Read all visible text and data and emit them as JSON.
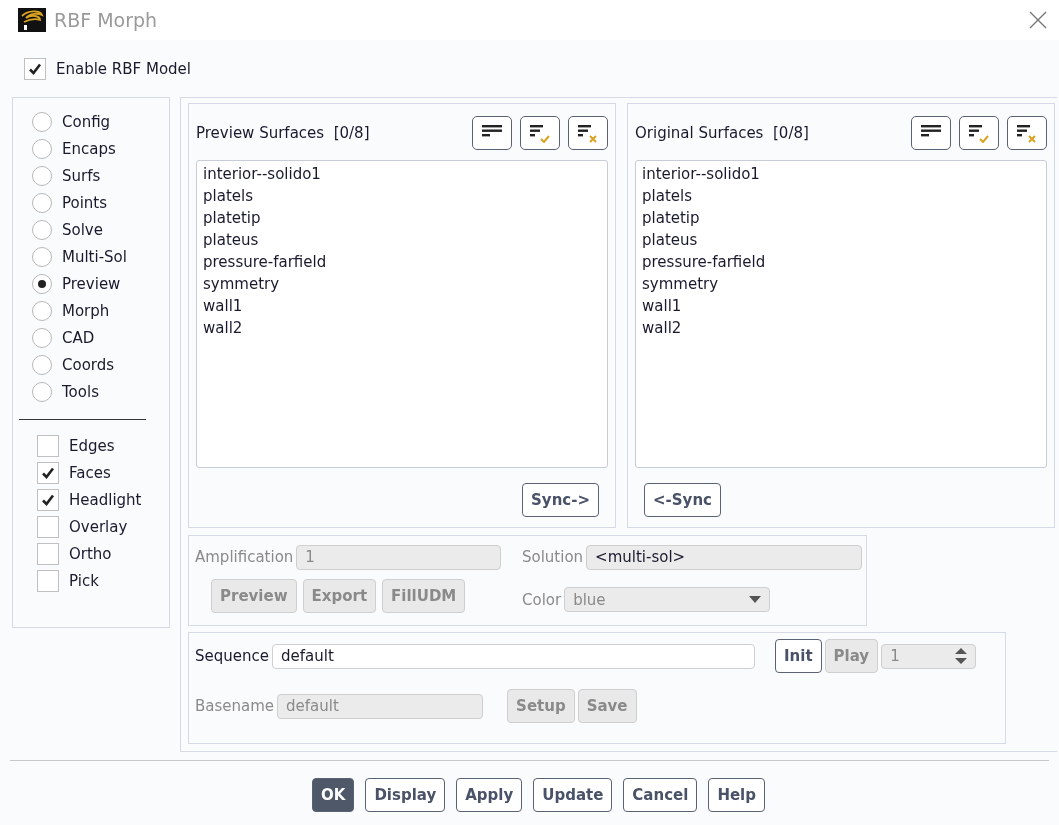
{
  "window": {
    "title": "RBF Morph"
  },
  "enable_rbf_model": {
    "label": "Enable RBF Model",
    "checked": true
  },
  "modes": [
    {
      "label": "Config",
      "selected": false
    },
    {
      "label": "Encaps",
      "selected": false
    },
    {
      "label": "Surfs",
      "selected": false
    },
    {
      "label": "Points",
      "selected": false
    },
    {
      "label": "Solve",
      "selected": false
    },
    {
      "label": "Multi-Sol",
      "selected": false
    },
    {
      "label": "Preview",
      "selected": true
    },
    {
      "label": "Morph",
      "selected": false
    },
    {
      "label": "CAD",
      "selected": false
    },
    {
      "label": "Coords",
      "selected": false
    },
    {
      "label": "Tools",
      "selected": false
    }
  ],
  "display_options": [
    {
      "label": "Edges",
      "checked": false
    },
    {
      "label": "Faces",
      "checked": true
    },
    {
      "label": "Headlight",
      "checked": true
    },
    {
      "label": "Overlay",
      "checked": false
    },
    {
      "label": "Ortho",
      "checked": false
    },
    {
      "label": "Pick",
      "checked": false
    }
  ],
  "surface_lists": [
    {
      "title": "Preview Surfaces",
      "count": "[0/8]",
      "sync_button": "Sync->",
      "items": [
        {
          "label": "interior--solido1",
          "selected": false
        },
        {
          "label": "platels",
          "selected": false
        },
        {
          "label": "platetip",
          "selected": false
        },
        {
          "label": "plateus",
          "selected": false
        },
        {
          "label": "pressure-farfield",
          "selected": false
        },
        {
          "label": "symmetry",
          "selected": false
        },
        {
          "label": "wall1",
          "selected": false
        },
        {
          "label": "wall2",
          "selected": false
        }
      ]
    },
    {
      "title": "Original Surfaces",
      "count": "[0/8]",
      "sync_button": "<-Sync",
      "items": [
        {
          "label": "interior--solido1",
          "selected": false
        },
        {
          "label": "platels",
          "selected": false
        },
        {
          "label": "platetip",
          "selected": false
        },
        {
          "label": "plateus",
          "selected": false
        },
        {
          "label": "pressure-farfield",
          "selected": false
        },
        {
          "label": "symmetry",
          "selected": false
        },
        {
          "label": "wall1",
          "selected": false
        },
        {
          "label": "wall2",
          "selected": false
        }
      ]
    }
  ],
  "preview_panel": {
    "amplification": {
      "label": "Amplification",
      "value": "1",
      "disabled": true
    },
    "buttons": [
      {
        "label": "Preview",
        "disabled": true
      },
      {
        "label": "Export",
        "disabled": true
      },
      {
        "label": "FillUDM",
        "disabled": true
      }
    ],
    "solution": {
      "label": "Solution",
      "value": "<multi-sol>",
      "disabled": false
    },
    "color": {
      "label": "Color",
      "value": "blue",
      "disabled": true
    }
  },
  "sequence_panel": {
    "sequence": {
      "label": "Sequence",
      "value": "default",
      "disabled": false
    },
    "init_button": {
      "label": "Init",
      "disabled": false
    },
    "play_button": {
      "label": "Play",
      "disabled": true
    },
    "frame": {
      "value": "1",
      "disabled": true
    },
    "basename": {
      "label": "Basename",
      "value": "default",
      "disabled": true
    },
    "buttons": [
      {
        "label": "Setup",
        "disabled": true
      },
      {
        "label": "Save",
        "disabled": true
      }
    ]
  },
  "footer_buttons": [
    {
      "label": "OK",
      "primary": true
    },
    {
      "label": "Display",
      "primary": false
    },
    {
      "label": "Apply",
      "primary": false
    },
    {
      "label": "Update",
      "primary": false
    },
    {
      "label": "Cancel",
      "primary": false
    },
    {
      "label": "Help",
      "primary": false
    }
  ]
}
